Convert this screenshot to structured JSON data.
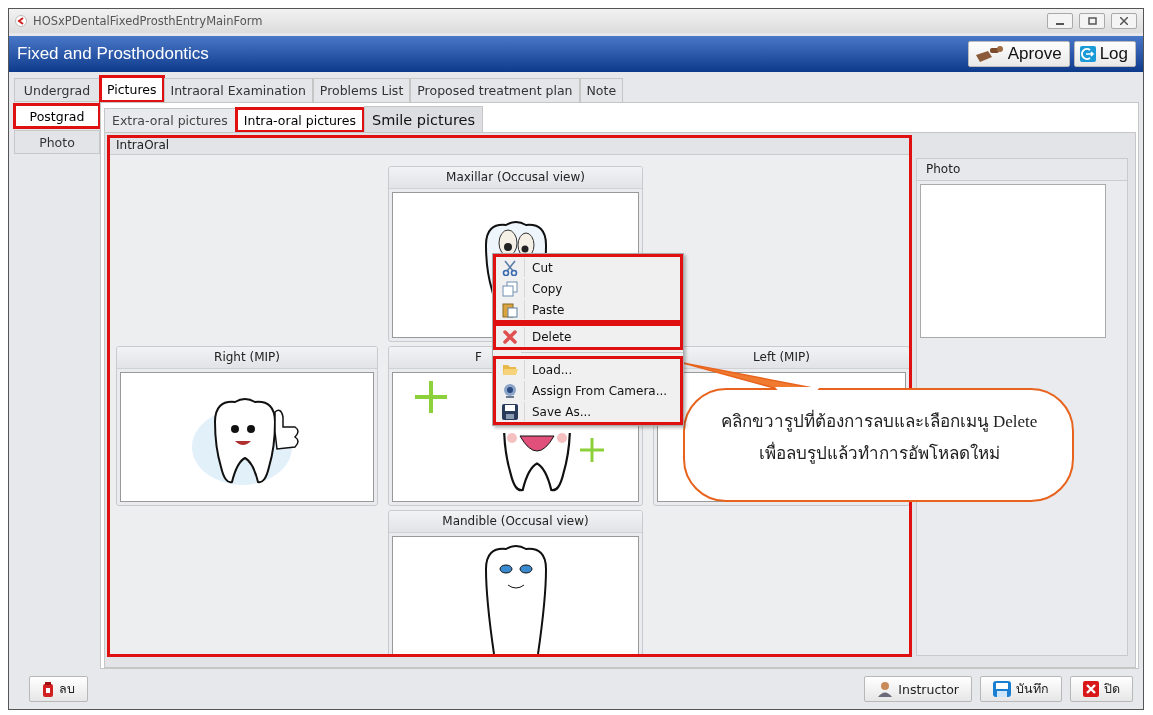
{
  "window": {
    "title": "HOSxPDentalFixedProsthEntryMainForm"
  },
  "header": {
    "title": "Fixed and Prosthodontics",
    "buttons": [
      {
        "kind": "approve",
        "label": "Aprove"
      },
      {
        "kind": "log",
        "label": "Log"
      }
    ]
  },
  "side_tabs": [
    {
      "label": "Undergrad",
      "selected": false,
      "highlighted": false
    },
    {
      "label": "Postgrad",
      "selected": true,
      "highlighted": true
    },
    {
      "label": "Photo",
      "selected": false,
      "highlighted": false
    }
  ],
  "tabs": [
    {
      "label": "Pictures",
      "selected": true,
      "highlighted": true
    },
    {
      "label": "Intraoral Examination",
      "selected": false,
      "highlighted": false
    },
    {
      "label": "Problems List",
      "selected": false,
      "highlighted": false
    },
    {
      "label": "Proposed treatment plan",
      "selected": false,
      "highlighted": false
    },
    {
      "label": "Note",
      "selected": false,
      "highlighted": false
    }
  ],
  "sub_tabs": [
    {
      "label": "Extra-oral pictures",
      "selected": false,
      "hovered": false,
      "highlighted": false
    },
    {
      "label": "Intra-oral pictures",
      "selected": true,
      "hovered": false,
      "highlighted": true
    },
    {
      "label": "Smile pictures",
      "selected": false,
      "hovered": true,
      "highlighted": false
    }
  ],
  "group": {
    "title": "IntraOral",
    "highlighted": true,
    "panels": [
      {
        "title": "Maxillar (Occusal view)"
      },
      {
        "title": "Right (MIP)"
      },
      {
        "title": "F"
      },
      {
        "title": "Left (MIP)"
      },
      {
        "title": "Mandible (Occusal view)"
      }
    ]
  },
  "photo_panel": {
    "title": "Photo"
  },
  "context_menu": {
    "groups": [
      {
        "highlighted": true,
        "items": [
          {
            "label": "Cut"
          },
          {
            "label": "Copy"
          },
          {
            "label": "Paste"
          }
        ]
      },
      {
        "highlighted": true,
        "items": [
          {
            "label": "Delete"
          }
        ]
      },
      {
        "highlighted": true,
        "items": [
          {
            "label": "Load..."
          },
          {
            "label": "Assign From Camera..."
          },
          {
            "label": "Save As..."
          }
        ]
      }
    ]
  },
  "callout": {
    "lines": [
      "คลิกขวารูปที่ต้องการลบและเลือกเมนู Delete",
      "เพื่อลบรูปแล้วทำการอัพโหลดใหม่"
    ]
  },
  "footer": {
    "left_buttons": [
      {
        "kind": "delete",
        "label": "ลบ"
      }
    ],
    "right_buttons": [
      {
        "kind": "instructor",
        "label": "Instructor"
      },
      {
        "kind": "save",
        "label": "บันทึก"
      },
      {
        "kind": "close",
        "label": "ปิด"
      }
    ]
  }
}
